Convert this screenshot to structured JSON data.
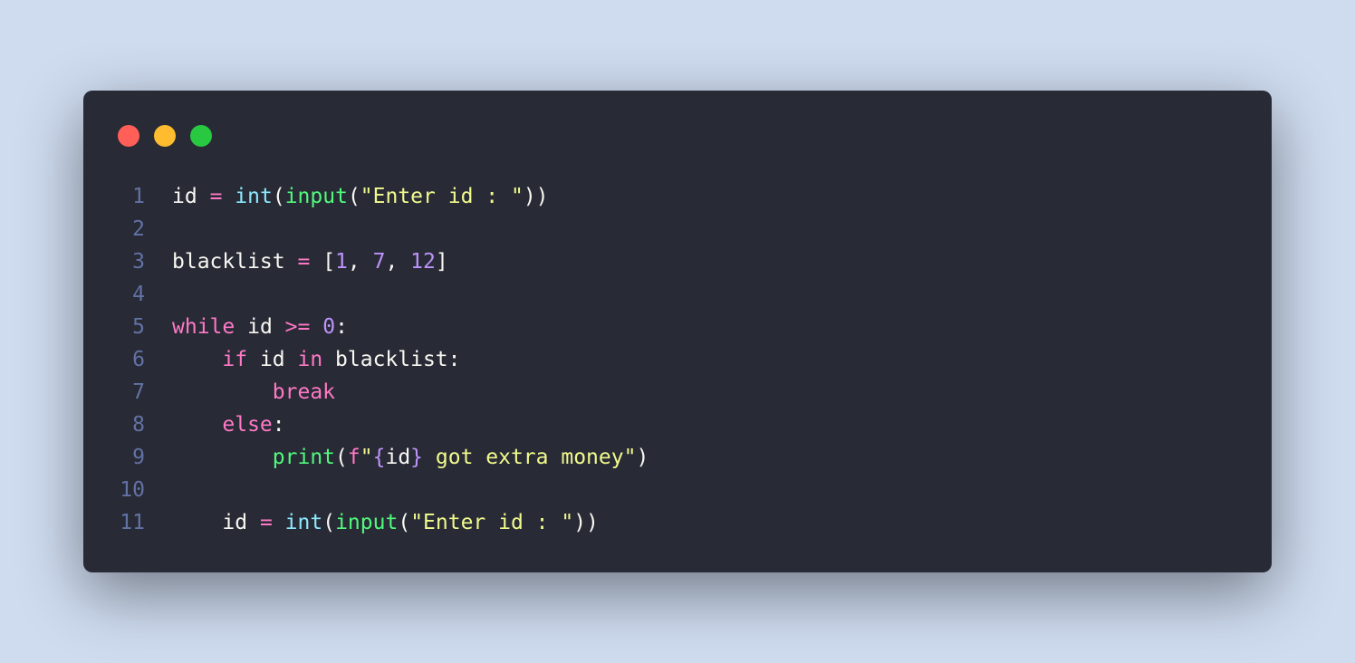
{
  "window": {
    "buttons": [
      {
        "name": "close-button",
        "color": "#ff5f57"
      },
      {
        "name": "minimize-button",
        "color": "#febc2e"
      },
      {
        "name": "maximize-button",
        "color": "#28c840"
      }
    ]
  },
  "editor": {
    "language": "python",
    "lines": [
      {
        "number": "1",
        "tokens": [
          {
            "t": "id",
            "k": "plain"
          },
          {
            "t": " ",
            "k": "plain"
          },
          {
            "t": "=",
            "k": "op"
          },
          {
            "t": " ",
            "k": "plain"
          },
          {
            "t": "int",
            "k": "type"
          },
          {
            "t": "(",
            "k": "plain"
          },
          {
            "t": "input",
            "k": "fn"
          },
          {
            "t": "(",
            "k": "plain"
          },
          {
            "t": "\"Enter id : \"",
            "k": "str"
          },
          {
            "t": "))",
            "k": "plain"
          }
        ]
      },
      {
        "number": "2",
        "tokens": []
      },
      {
        "number": "3",
        "tokens": [
          {
            "t": "blacklist",
            "k": "plain"
          },
          {
            "t": " ",
            "k": "plain"
          },
          {
            "t": "=",
            "k": "op"
          },
          {
            "t": " [",
            "k": "plain"
          },
          {
            "t": "1",
            "k": "num"
          },
          {
            "t": ", ",
            "k": "plain"
          },
          {
            "t": "7",
            "k": "num"
          },
          {
            "t": ", ",
            "k": "plain"
          },
          {
            "t": "12",
            "k": "num"
          },
          {
            "t": "]",
            "k": "plain"
          }
        ]
      },
      {
        "number": "4",
        "tokens": []
      },
      {
        "number": "5",
        "tokens": [
          {
            "t": "while",
            "k": "kw"
          },
          {
            "t": " id ",
            "k": "plain"
          },
          {
            "t": ">=",
            "k": "op"
          },
          {
            "t": " ",
            "k": "plain"
          },
          {
            "t": "0",
            "k": "num"
          },
          {
            "t": ":",
            "k": "plain"
          }
        ]
      },
      {
        "number": "6",
        "tokens": [
          {
            "t": "    ",
            "k": "plain"
          },
          {
            "t": "if",
            "k": "kw"
          },
          {
            "t": " id ",
            "k": "plain"
          },
          {
            "t": "in",
            "k": "kw"
          },
          {
            "t": " blacklist:",
            "k": "plain"
          }
        ]
      },
      {
        "number": "7",
        "tokens": [
          {
            "t": "        ",
            "k": "plain"
          },
          {
            "t": "break",
            "k": "kw"
          }
        ]
      },
      {
        "number": "8",
        "tokens": [
          {
            "t": "    ",
            "k": "plain"
          },
          {
            "t": "else",
            "k": "kw"
          },
          {
            "t": ":",
            "k": "plain"
          }
        ]
      },
      {
        "number": "9",
        "tokens": [
          {
            "t": "        ",
            "k": "plain"
          },
          {
            "t": "print",
            "k": "fn"
          },
          {
            "t": "(",
            "k": "plain"
          },
          {
            "t": "f",
            "k": "kw"
          },
          {
            "t": "\"",
            "k": "str"
          },
          {
            "t": "{",
            "k": "brace"
          },
          {
            "t": "id",
            "k": "plain"
          },
          {
            "t": "}",
            "k": "brace"
          },
          {
            "t": " got extra money\"",
            "k": "str"
          },
          {
            "t": ")",
            "k": "plain"
          }
        ]
      },
      {
        "number": "10",
        "tokens": []
      },
      {
        "number": "11",
        "tokens": [
          {
            "t": "    ",
            "k": "plain"
          },
          {
            "t": "id",
            "k": "plain"
          },
          {
            "t": " ",
            "k": "plain"
          },
          {
            "t": "=",
            "k": "op"
          },
          {
            "t": " ",
            "k": "plain"
          },
          {
            "t": "int",
            "k": "type"
          },
          {
            "t": "(",
            "k": "plain"
          },
          {
            "t": "input",
            "k": "fn"
          },
          {
            "t": "(",
            "k": "plain"
          },
          {
            "t": "\"Enter id : \"",
            "k": "str"
          },
          {
            "t": "))",
            "k": "plain"
          }
        ]
      }
    ]
  }
}
